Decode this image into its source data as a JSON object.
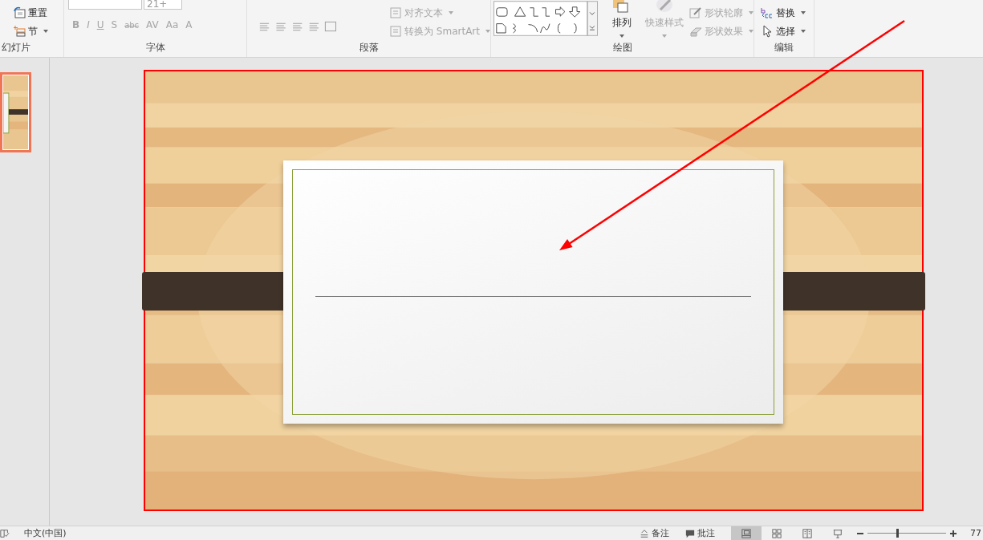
{
  "ribbon": {
    "slides_group": {
      "label": "幻灯片",
      "buttons": [
        {
          "label": "重置"
        },
        {
          "label": "节"
        }
      ]
    },
    "font_group": {
      "label": "字体",
      "font_size": "21+",
      "format_buttons": [
        {
          "label": "B",
          "disabled": true
        },
        {
          "label": "I",
          "disabled": true
        },
        {
          "label": "U",
          "disabled": true
        },
        {
          "label": "S",
          "disabled": true
        },
        {
          "label": "abc",
          "disabled": true
        },
        {
          "label": "AV",
          "disabled": true
        },
        {
          "label": "Aa",
          "disabled": true
        },
        {
          "label": "A",
          "disabled": true
        }
      ]
    },
    "paragraph_group": {
      "label": "段落",
      "buttons": [
        {
          "label": "对齐文本",
          "disabled": true
        },
        {
          "label": "转换为 SmartArt",
          "disabled": true
        }
      ]
    },
    "drawing_group": {
      "label": "绘图",
      "arrange": {
        "label": "排列",
        "disabled": false
      },
      "quick_styles": {
        "label": "快速样式",
        "disabled": true
      },
      "buttons": [
        {
          "label": "形状轮廓",
          "disabled": true
        },
        {
          "label": "形状效果",
          "disabled": true
        }
      ]
    },
    "editing_group": {
      "label": "编辑",
      "buttons": [
        {
          "label": "替换",
          "disabled": false
        },
        {
          "label": "选择",
          "disabled": false
        }
      ]
    }
  },
  "thumbnails": [
    {
      "selected": true
    }
  ],
  "status_bar": {
    "language": "中文(中国)",
    "notes": "备注",
    "comments": "批注",
    "views": [
      {
        "selected": true
      },
      {
        "selected": false
      },
      {
        "selected": false
      },
      {
        "selected": false
      }
    ],
    "zoom": {
      "level": 0.38,
      "reading": "77"
    }
  }
}
